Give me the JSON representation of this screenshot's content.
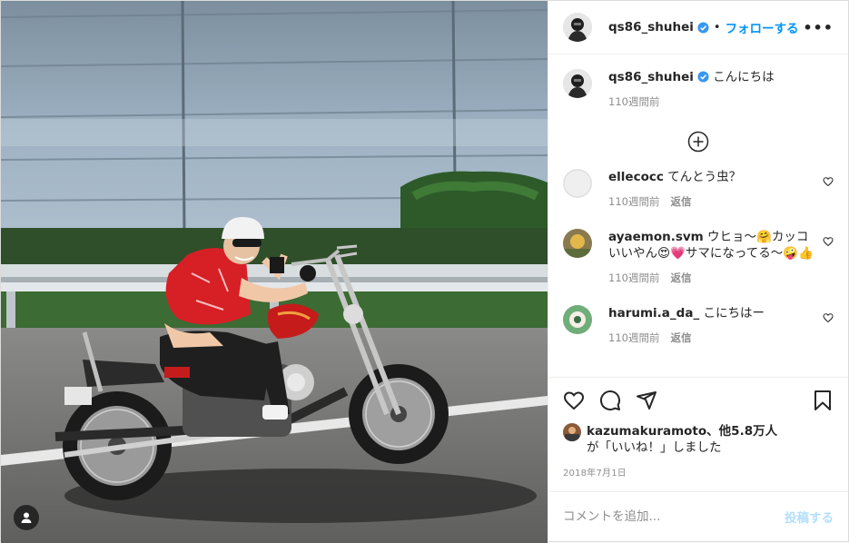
{
  "header": {
    "username": "qs86_shuhei",
    "verified_icon": "verified-badge-icon",
    "separator": "•",
    "follow_label": "フォローする",
    "more_label": "•••"
  },
  "caption": {
    "username": "qs86_shuhei",
    "text": "こんにちは",
    "time": "110週間前"
  },
  "comments": [
    {
      "username": "ellecocc",
      "text": "てんとう虫？",
      "time": "110週間前",
      "reply": "返信"
    },
    {
      "username": "ayaemon.svm",
      "text": "ウヒョ〜🤗カッコいいやん😍💗サマになってる〜🤪👍",
      "time": "110週間前",
      "reply": "返信"
    },
    {
      "username": "harumi.a_da_",
      "text": "こにちはー",
      "time": "110週間前",
      "reply": "返信"
    }
  ],
  "likes": {
    "first_user": "kazumakuramoto",
    "others": "、他5.8万人",
    "suffix": "が「いいね！」しました"
  },
  "date": "2018年7月1日",
  "comment_input": {
    "placeholder": "コメントを追加...",
    "post_label": "投稿する"
  },
  "colors": {
    "link_blue": "#0095f6",
    "disabled_blue": "#b2dffc",
    "muted": "#8e8e8e"
  }
}
